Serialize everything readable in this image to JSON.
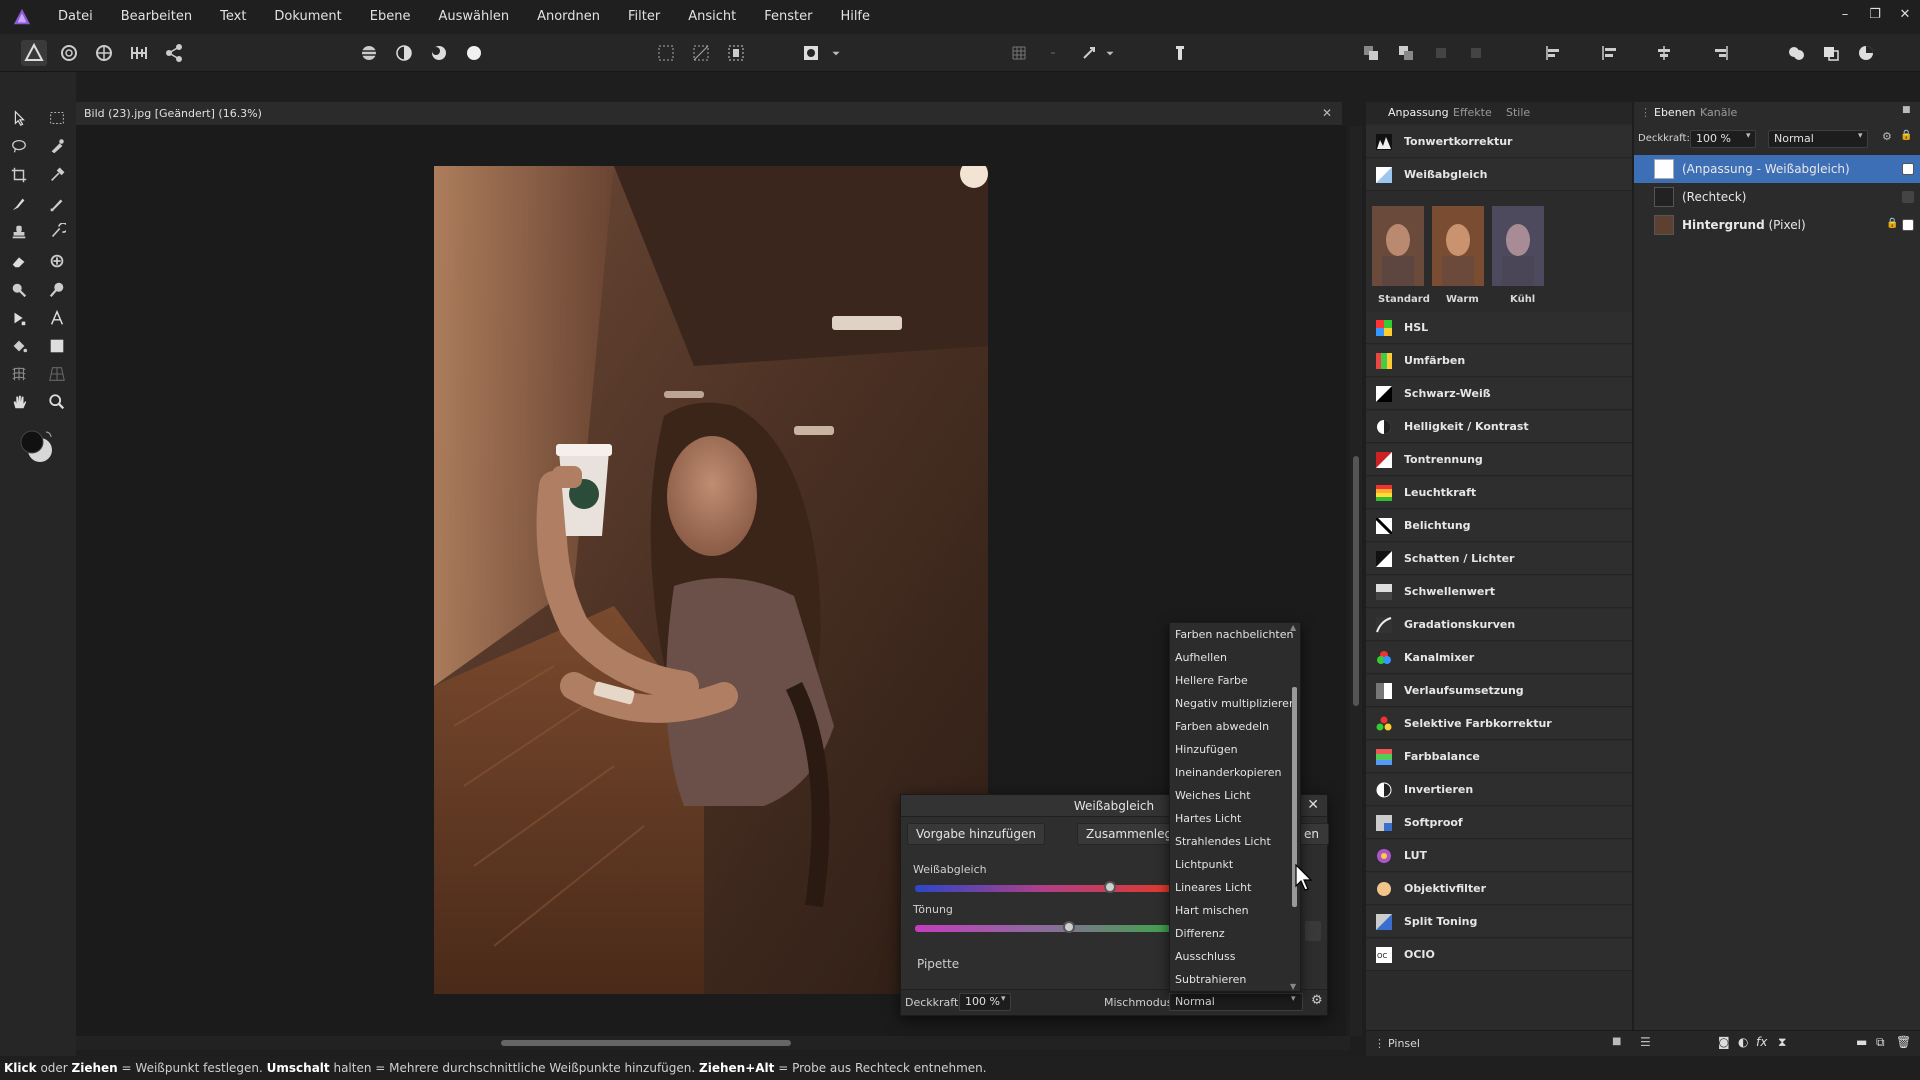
{
  "menu": [
    "Datei",
    "Bearbeiten",
    "Text",
    "Dokument",
    "Ebene",
    "Auswählen",
    "Anordnen",
    "Filter",
    "Ansicht",
    "Fenster",
    "Hilfe"
  ],
  "window_controls": {
    "minimize": "–",
    "restore": "❐",
    "close": "✕"
  },
  "document": {
    "tab_title": "Bild (23).jpg [Geändert] (16.3%)",
    "close": "✕"
  },
  "wb_dialog": {
    "title": "Weißabgleich",
    "add_preset": "Vorgabe hinzufügen",
    "merge": "Zusammenlegen",
    "hidden_btn_tail": "en",
    "wb_label": "Weißabgleich",
    "tint_label": "Tönung",
    "pipette": "Pipette",
    "opacity_label": "Deckkraft:",
    "opacity_value": "100 %",
    "blend_label": "Mischmodus:",
    "blend_value": "Normal",
    "wb_position": 0.76,
    "tint_position": 0.6
  },
  "blend_options": [
    "Farben nachbelichten",
    "Aufhellen",
    "Hellere Farbe",
    "Negativ multiplizieren",
    "Farben abwedeln",
    "Hinzufügen",
    "Ineinanderkopieren",
    "Weiches Licht",
    "Hartes Licht",
    "Strahlendes Licht",
    "Lichtpunkt",
    "Lineares Licht",
    "Hart mischen",
    "Differenz",
    "Ausschluss",
    "Subtrahieren"
  ],
  "adj_panel": {
    "tabs": [
      "Anpassung",
      "Effekte",
      "Stile"
    ],
    "top_items": [
      "Tonwertkorrektur",
      "Weißabgleich"
    ],
    "presets": [
      "Standard",
      "Warm",
      "Kühl"
    ],
    "items": [
      "HSL",
      "Umfärben",
      "Schwarz-Weiß",
      "Helligkeit / Kontrast",
      "Tontrennung",
      "Leuchtkraft",
      "Belichtung",
      "Schatten / Lichter",
      "Schwellenwert",
      "Gradationskurven",
      "Kanalmixer",
      "Verlaufsumsetzung",
      "Selektive Farbkorrektur",
      "Farbbalance",
      "Invertieren",
      "Softproof",
      "LUT",
      "Objektivfilter",
      "Split Toning",
      "OCIO"
    ],
    "brush_tab": "Pinsel"
  },
  "layers_panel": {
    "tabs": [
      "Ebenen",
      "Kanäle"
    ],
    "opacity_label": "Deckkraft:",
    "opacity_value": "100 %",
    "blend_value": "Normal",
    "layers": [
      {
        "name": "(Anpassung - Weißabgleich)",
        "suffix": ""
      },
      {
        "name": "(Rechteck)",
        "suffix": ""
      },
      {
        "name": "Hintergrund",
        "suffix": " (Pixel)"
      }
    ]
  },
  "status": {
    "k1": "Klick",
    "t1": " oder ",
    "k2": "Ziehen",
    "t2": " = Weißpunkt festlegen. ",
    "k3": "Umschalt",
    "t3": " halten = Mehrere durchschnittliche Weißpunkte hinzufügen. ",
    "k4": "Ziehen+Alt",
    "t4": " = Probe aus Rechteck entnehmen."
  },
  "colors": {
    "accent": "#3f74c4",
    "selected_layer": "#3d6fb6"
  }
}
